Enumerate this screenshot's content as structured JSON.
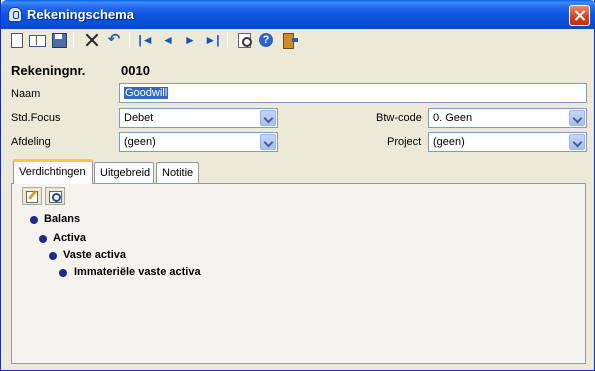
{
  "window": {
    "title": "Rekeningschema"
  },
  "toolbar": {
    "buttons": [
      "new-icon",
      "open-icon",
      "save-icon",
      "delete-icon",
      "undo-icon",
      "first-record-icon",
      "previous-record-icon",
      "next-record-icon",
      "last-record-icon",
      "print-preview-icon",
      "help-icon",
      "exit-icon"
    ],
    "undo_glyph": "↶",
    "first_glyph": "|◄",
    "prev_glyph": "◄",
    "next_glyph": "►",
    "last_glyph": "►|"
  },
  "form": {
    "account_label": "Rekeningnr.",
    "account_value": "0010",
    "name_label": "Naam",
    "name_value": "Goodwill",
    "stdfocus_label": "Std.Focus",
    "stdfocus_value": "Debet",
    "btw_label": "Btw-code",
    "btw_value": "0. Geen",
    "afdeling_label": "Afdeling",
    "afdeling_value": "(geen)",
    "project_label": "Project",
    "project_value": "(geen)"
  },
  "tabs": [
    {
      "label": "Verdichtingen",
      "active": true
    },
    {
      "label": "Uitgebreid",
      "active": false
    },
    {
      "label": "Notitie",
      "active": false
    }
  ],
  "tree": [
    {
      "label": "Balans",
      "level": 0
    },
    {
      "label": "Activa",
      "level": 1
    },
    {
      "label": "Vaste activa",
      "level": 2
    },
    {
      "label": "Immateriële vaste activa",
      "level": 3
    }
  ],
  "colors": {
    "titlebar": "#0a4fd8",
    "selection": "#316ac5",
    "bullet": "#1c2a8c",
    "active_tab_accent": "#ffc83c"
  }
}
